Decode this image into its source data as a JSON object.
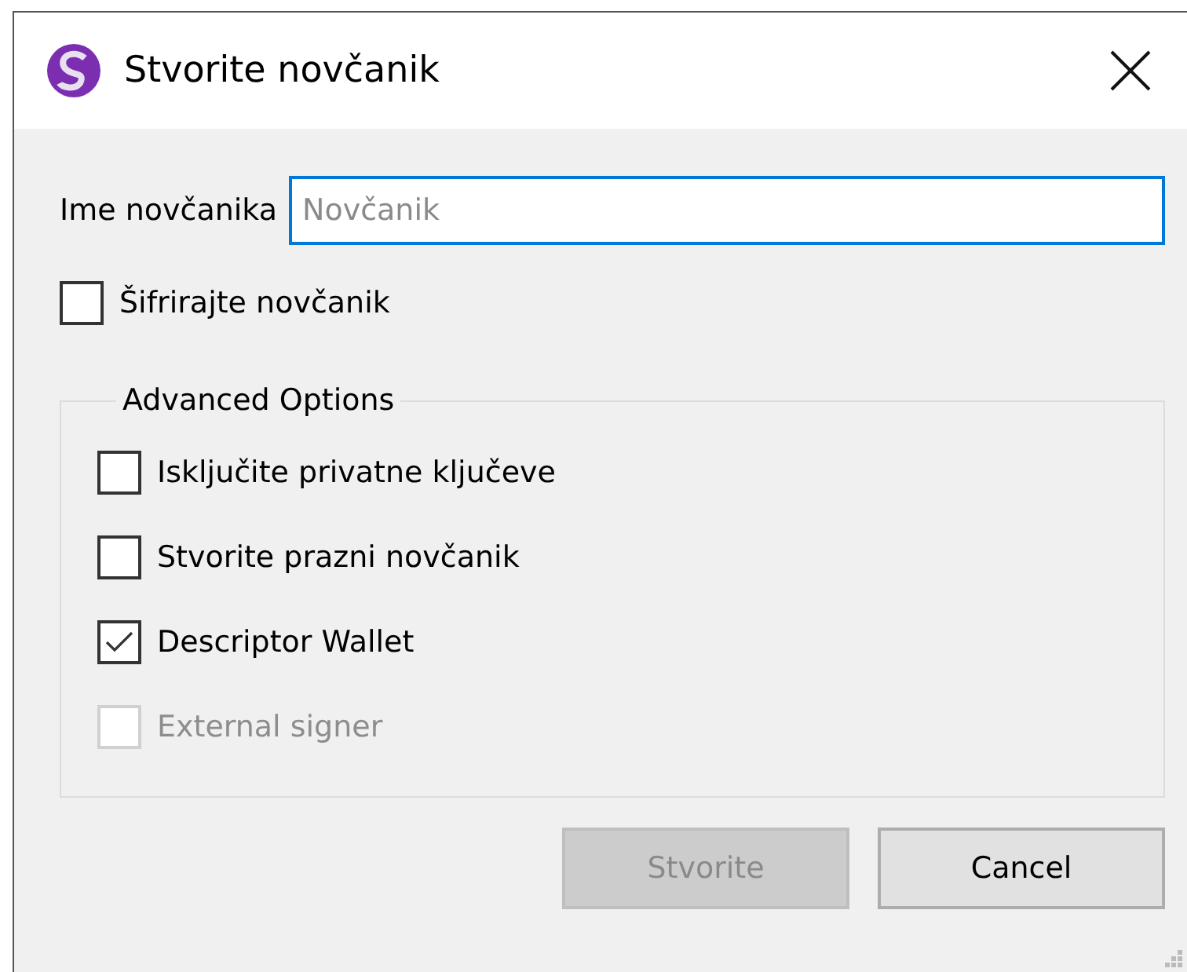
{
  "window": {
    "title": "Stvorite novčanik"
  },
  "name_field": {
    "label": "Ime novčanika",
    "placeholder": "Novčanik",
    "focused": true
  },
  "encrypt": {
    "label": "Šifrirajte novčanik",
    "checked": false,
    "disabled": false
  },
  "advanced": {
    "title": "Advanced Options",
    "options": [
      {
        "label": "Isključite privatne ključeve",
        "checked": false,
        "disabled": false
      },
      {
        "label": "Stvorite prazni novčanik",
        "checked": false,
        "disabled": false
      },
      {
        "label": "Descriptor Wallet",
        "checked": true,
        "disabled": false
      },
      {
        "label": "External signer",
        "checked": false,
        "disabled": true
      }
    ]
  },
  "buttons": [
    {
      "label": "Stvorite",
      "disabled": true
    },
    {
      "label": "Cancel",
      "disabled": false
    }
  ]
}
